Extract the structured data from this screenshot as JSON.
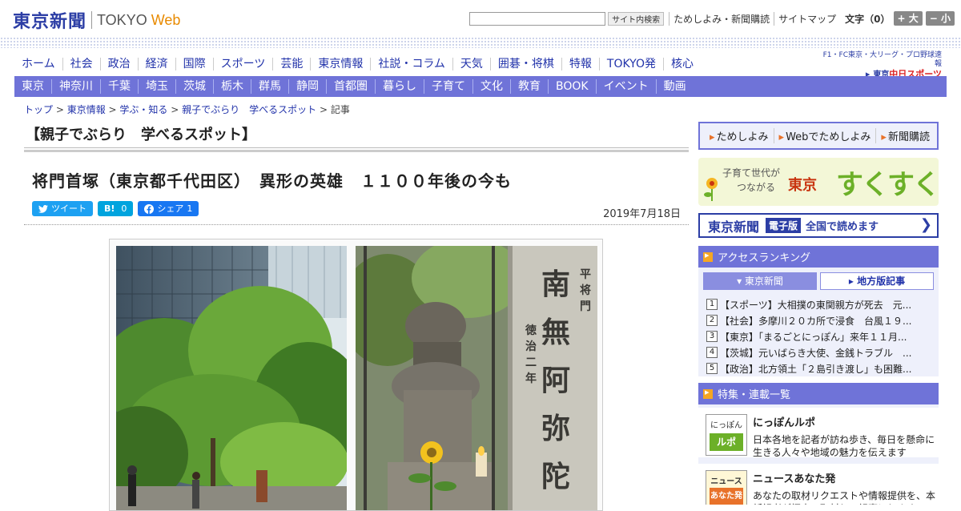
{
  "header": {
    "logo_jp": "東京新聞",
    "logo_en": "TOKYO",
    "logo_en_accent": "Web",
    "search_placeholder": "",
    "search_button": "サイト内検索",
    "links": [
      "ためしよみ・新聞購読",
      "サイトマップ"
    ],
    "font_label": "文字（0）",
    "font_up": "+ 大",
    "font_down": "− 小"
  },
  "nav_main": [
    "ホーム",
    "社会",
    "政治",
    "経済",
    "国際",
    "スポーツ",
    "芸能",
    "東京情報",
    "社説・コラム",
    "天気",
    "囲碁・将棋",
    "特報",
    "TOKYO発",
    "核心"
  ],
  "sports_logo": {
    "top": "F1・FC東京・大リーグ・プロ野球速報",
    "brand_a": "東京",
    "brand_b": "中日スポーツ"
  },
  "nav_sub": [
    "東京",
    "神奈川",
    "千葉",
    "埼玉",
    "茨城",
    "栃木",
    "群馬",
    "静岡",
    "首都圏",
    "暮らし",
    "子育て",
    "文化",
    "教育",
    "BOOK",
    "イベント",
    "動画"
  ],
  "breadcrumb": [
    "トップ",
    "東京情報",
    "学ぶ・知る",
    "親子でぶらり　学べるスポット",
    "記事"
  ],
  "article": {
    "series": "【親子でぶらり　学べるスポット】",
    "headline": "将門首塚（東京都千代田区）　異形の英雄　１１００年後の今も",
    "date": "2019年7月18日",
    "social": {
      "tweet": "ツイート",
      "hatena_label": "B!",
      "hatena_count": "0",
      "share_label": "シェア",
      "share_count": "1"
    }
  },
  "sidebar": {
    "links": [
      "ためしよみ",
      "Webでためしよみ",
      "新聞購読"
    ],
    "banner_suku": {
      "sub_line1": "子育て世代が",
      "sub_line2": "つながる",
      "tokyo": "東京",
      "main": "すくすく"
    },
    "banner_denshi": {
      "logo": "東京新聞",
      "tag": "電子版",
      "msg": "全国で読めます"
    },
    "ranking": {
      "heading": "アクセスランキング",
      "tab_active": "東京新聞",
      "tab_other": "地方版記事",
      "items": [
        {
          "num": "1",
          "text": "【スポーツ】大相撲の東関親方が死去　元..."
        },
        {
          "num": "2",
          "text": "【社会】多摩川２０カ所で浸食　台風１９..."
        },
        {
          "num": "3",
          "text": "【東京】「まるごとにっぽん」来年１１月..."
        },
        {
          "num": "4",
          "text": "【茨城】元いばらき大使、金銭トラブル　..."
        },
        {
          "num": "5",
          "text": "【政治】北方領土「２島引き渡し」も困難..."
        }
      ]
    },
    "features": {
      "heading": "特集・連載一覧",
      "items": [
        {
          "title": "にっぽんルポ",
          "desc": "日本各地を記者が訪ね歩き、毎日を懸命に生きる人々や地域の魅力を伝えます",
          "thumb_line1": "にっぽん",
          "thumb_line2": "ルポ"
        },
        {
          "title": "ニュースあなた発",
          "desc": "あなたの取材リクエストや情報提供を、本紙記者が探索・取材し、記事にします",
          "thumb_line1": "ニュース",
          "thumb_line2": "あなた発"
        }
      ]
    }
  },
  "colors": {
    "brand": "#2c3ea5",
    "nav_bar": "#6f73d8",
    "accent_orange": "#e8722a"
  }
}
